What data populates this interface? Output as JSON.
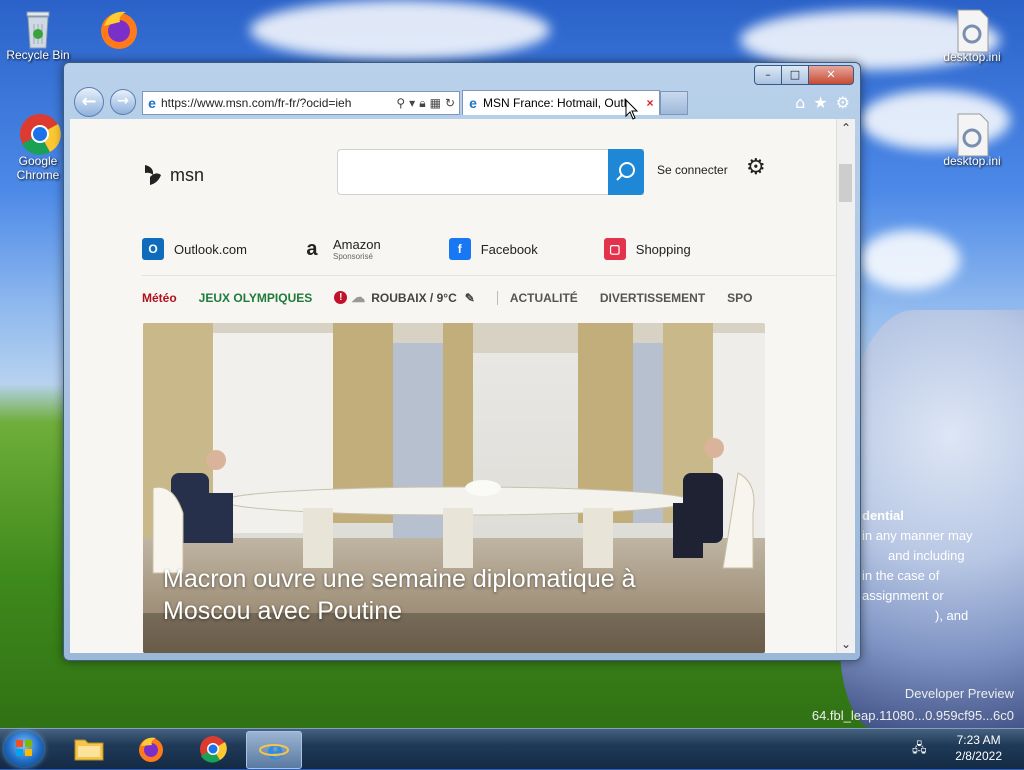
{
  "desktop": {
    "icons": [
      {
        "label": "Recycle Bin",
        "icon": "recycle-bin-icon"
      },
      {
        "label": "",
        "icon": "firefox-icon"
      },
      {
        "label": "Google Chrome",
        "icon": "chrome-icon"
      },
      {
        "label": "desktop.ini",
        "icon": "settings-file-icon"
      },
      {
        "label": "desktop.ini",
        "icon": "settings-file-icon"
      }
    ],
    "wallpaper_text": {
      "line1": "dential",
      "line2": "in any manner may",
      "line3": "and including",
      "line4": "in the case of",
      "line5": "assignment or",
      "line6": "), and"
    },
    "watermark": {
      "line1": "Developer Preview",
      "line2": "64.fbl_leap.11080...0.959cf95...6c0"
    }
  },
  "browser": {
    "address": "https://www.msn.com/fr-fr/?ocid=ieh",
    "tab_title": "MSN France: Hotmail, Outl",
    "tab_close": "×",
    "window_buttons": {
      "minimize": "–",
      "maximize": "□",
      "close": "✕"
    }
  },
  "msn": {
    "logo_text": "msn",
    "search_placeholder": "",
    "signin": "Se connecter",
    "quicklinks": [
      {
        "label": "Outlook.com",
        "sub": "",
        "icon": "outlook-icon",
        "color": "#0f6cbd"
      },
      {
        "label": "Amazon",
        "sub": "Sponsorisé",
        "icon": "amazon-icon",
        "color": "#222222"
      },
      {
        "label": "Facebook",
        "sub": "",
        "icon": "facebook-icon",
        "color": "#1877f2"
      },
      {
        "label": "Shopping",
        "sub": "",
        "icon": "shopping-bag-icon",
        "color": "#e2334c"
      }
    ],
    "nav": {
      "meteo": "Météo",
      "jo": "JEUX OLYMPIQUES",
      "weather": "ROUBAIX / 9°C",
      "categories": [
        "ACTUALITÉ",
        "DIVERTISSEMENT",
        "SPO"
      ]
    },
    "hero": {
      "headline_line1": "Macron ouvre une semaine diplomatique à",
      "headline_line2": "Moscou avec Poutine"
    }
  },
  "taskbar": {
    "time": "7:23 AM",
    "date": "2/8/2022",
    "items": [
      "file-explorer-icon",
      "firefox-icon",
      "chrome-icon",
      "internet-explorer-icon"
    ]
  }
}
